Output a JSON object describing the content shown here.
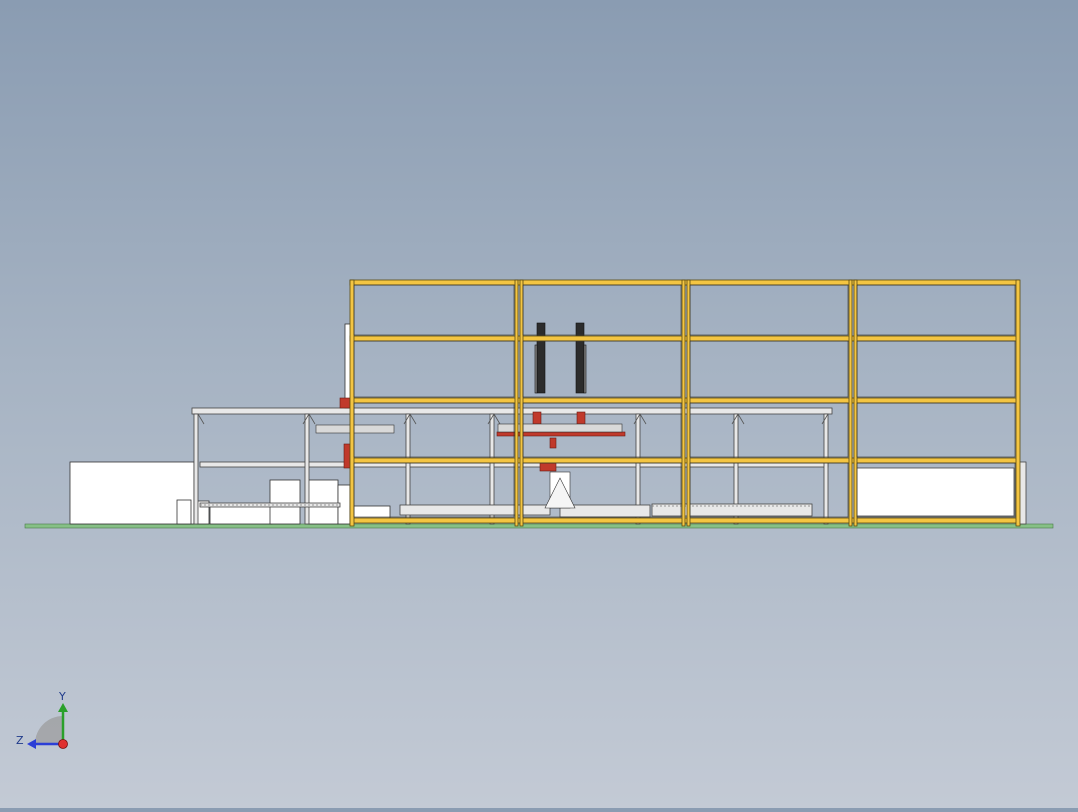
{
  "viewport": {
    "background_top": "#8a9cb2",
    "background_bottom": "#c3cad5",
    "frame_color": "#f4c542",
    "frame_outline": "#5a4a10",
    "ground_color": "#7fbf7f",
    "machine_fill": "#ffffff",
    "accent_red": "#c0392b"
  },
  "triad": {
    "y_label": "Y",
    "z_label": "Z",
    "x_axis_color": "#e03030",
    "y_axis_color": "#2aa02a",
    "z_axis_color": "#2c3fd6"
  }
}
